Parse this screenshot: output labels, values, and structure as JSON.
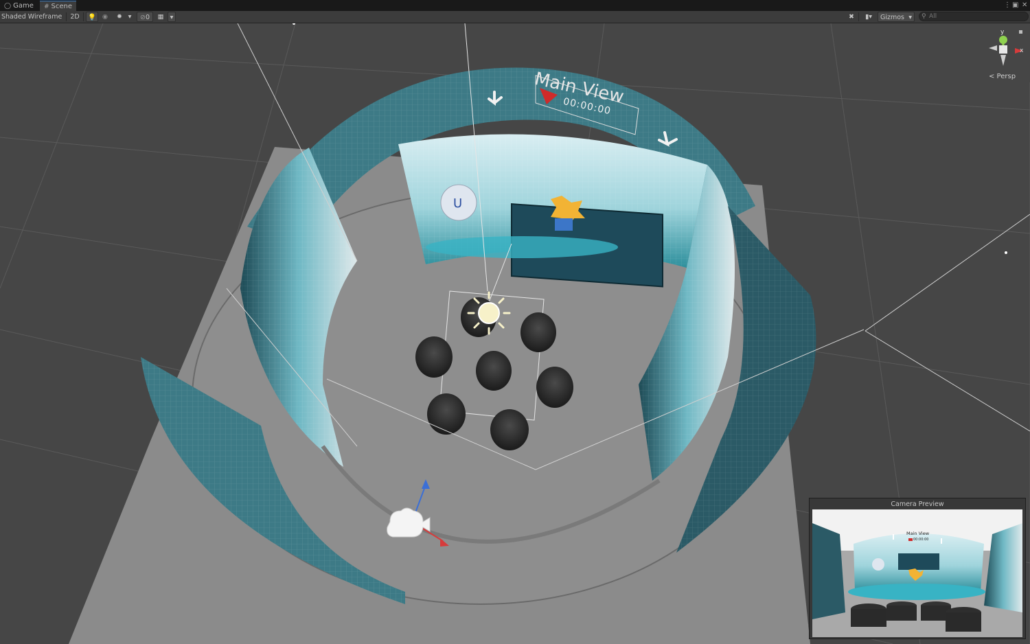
{
  "tabs": [
    {
      "label": "Game",
      "icon": "gamepad-icon"
    },
    {
      "label": "Scene",
      "icon": "grid-icon"
    }
  ],
  "toolbar": {
    "draw_mode": "Shaded Wireframe",
    "mode_2d": "2D",
    "hidden_count": "0",
    "gizmos": "Gizmos",
    "search_placeholder": "All"
  },
  "scene": {
    "title_3d": "Main View",
    "timer": "00:00:00",
    "projection": "< Persp",
    "axis_x": "x",
    "axis_y": "y"
  },
  "camera_preview": {
    "title": "Camera Preview",
    "inner_title": "Main View",
    "inner_timer": "00:00:00"
  },
  "colors": {
    "accent": "#3a79bb",
    "screen_teal": "#3d7a86",
    "floor": "#8b8b8b",
    "viewport_bg": "#464646"
  }
}
